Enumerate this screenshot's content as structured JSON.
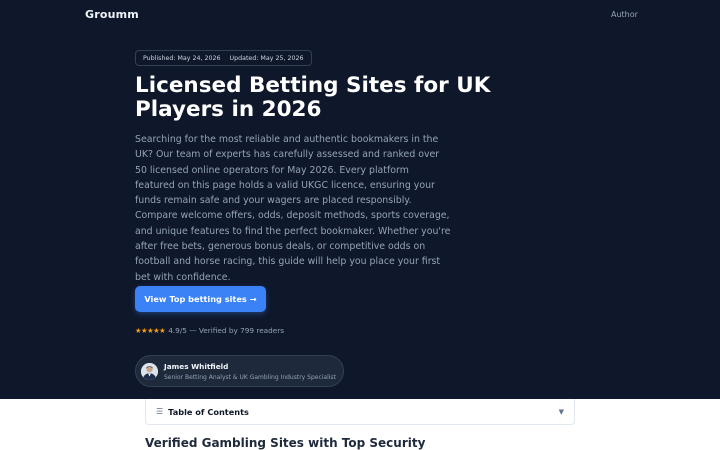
{
  "header": {
    "brand": "Groumm",
    "nav_author": "Author"
  },
  "meta": {
    "published": "Published: May 24, 2026",
    "updated": "Updated: May 25, 2026"
  },
  "hero": {
    "title": "Licensed Betting Sites for UK Players in 2026",
    "intro": "Searching for the most reliable and authentic bookmakers in the UK? Our team of experts has carefully assessed and ranked over 50 licensed online operators for May 2026. Every platform featured on this page holds a valid UKGC licence, ensuring your funds remain safe and your wagers are placed responsibly. Compare welcome offers, odds, deposit methods, sports coverage, and unique features to find the perfect bookmaker. Whether you're after free bets, generous bonus deals, or competitive odds on football and horse racing, this guide will help you place your first bet with confidence.",
    "cta_label": "View Top betting sites",
    "cta_arrow": "→"
  },
  "rating": {
    "stars": "★★★★★",
    "text": "4.9/5 — Verified by 799 readers"
  },
  "author": {
    "name": "James Whitfield",
    "role": "Senior Betting Analyst & UK Gambling Industry Specialist"
  },
  "toc": {
    "icon": "☰",
    "title": "Table of Contents",
    "chevron": "▼"
  },
  "section": {
    "title": "Verified Gambling Sites with Top Security"
  }
}
